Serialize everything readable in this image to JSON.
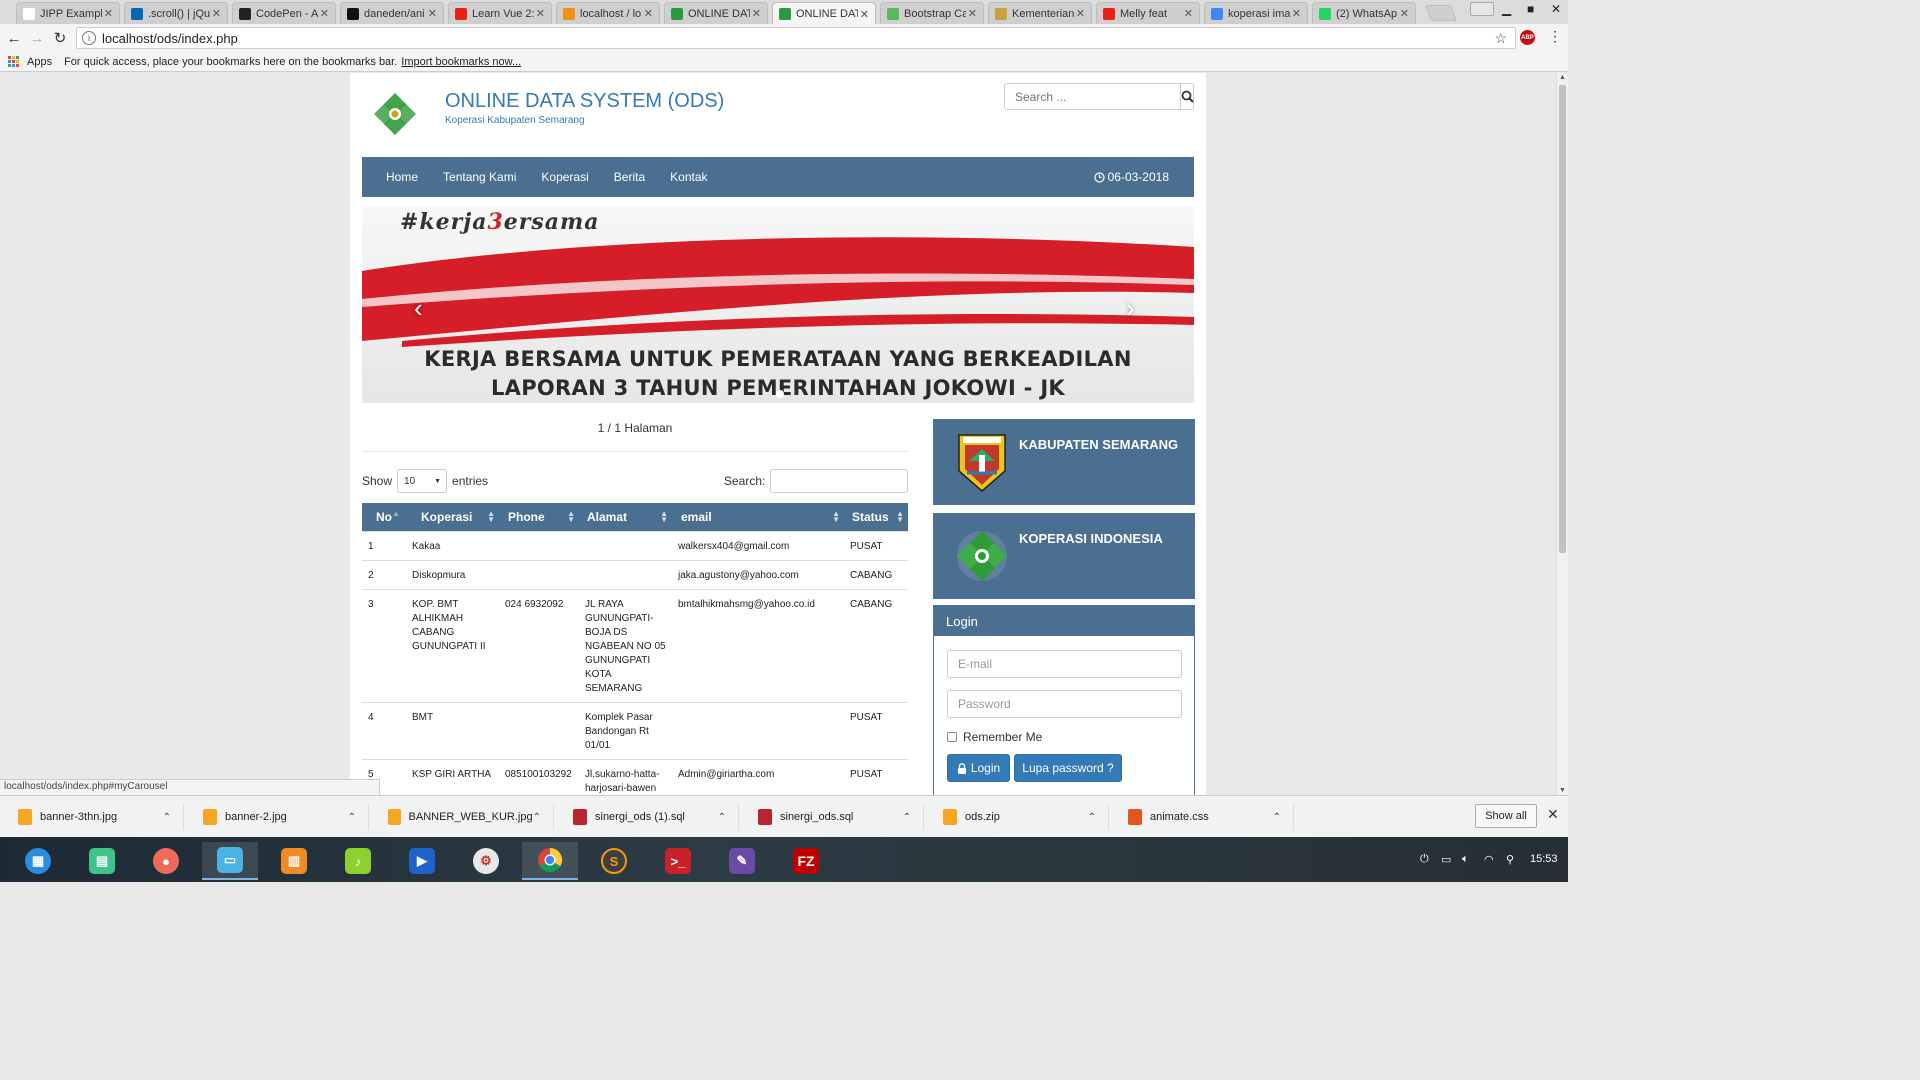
{
  "browser": {
    "tabs": [
      {
        "title": "JIPP Example",
        "fav_color": "#ffffff",
        "active": false
      },
      {
        "title": ".scroll() | jQu",
        "fav_color": "#0769ad",
        "active": false
      },
      {
        "title": "CodePen - Ai",
        "fav_color": "#222222",
        "active": false
      },
      {
        "title": "daneden/ani",
        "fav_color": "#111111",
        "active": false
      },
      {
        "title": "Learn Vue 2:",
        "fav_color": "#e62117",
        "active": false
      },
      {
        "title": "localhost / lo",
        "fav_color": "#f29111",
        "active": false
      },
      {
        "title": "ONLINE DAT",
        "fav_color": "#2b9a3e",
        "active": false
      },
      {
        "title": "ONLINE DAT",
        "fav_color": "#2b9a3e",
        "active": true
      },
      {
        "title": "Bootstrap Ca",
        "fav_color": "#5cb85c",
        "active": false
      },
      {
        "title": "Kementerian",
        "fav_color": "#c9a13b",
        "active": false
      },
      {
        "title": "Melly feat",
        "fav_color": "#e62117",
        "active": false
      },
      {
        "title": "koperasi ima",
        "fav_color": "#4285f4",
        "active": false
      },
      {
        "title": "(2) WhatsAp",
        "fav_color": "#25d366",
        "active": false
      }
    ],
    "url": "localhost/ods/index.php",
    "bookmarks": {
      "apps_label": "Apps",
      "hint": "For quick access, place your bookmarks here on the bookmarks bar.",
      "import_link": "Import bookmarks now..."
    },
    "status_url": "localhost/ods/index.php#myCarousel"
  },
  "site": {
    "title": "ONLINE DATA SYSTEM (ODS)",
    "subtitle": "Koperasi Kabupaten Semarang",
    "search_placeholder": "Search ...",
    "nav": [
      "Home",
      "Tentang Kami",
      "Koperasi",
      "Berita",
      "Kontak"
    ],
    "date": "06-03-2018",
    "banner": {
      "hashtag_prefix": "#kerja",
      "hashtag_mid": "3",
      "hashtag_suffix": "ersama",
      "line1": "KERJA BERSAMA UNTUK PEMERATAAN YANG BERKEADILAN",
      "line2": "LAPORAN 3 TAHUN PEMERINTAHAN JOKOWI - JK"
    },
    "pager": "1 / 1 Halaman",
    "table": {
      "show_label": "Show",
      "entries_value": "10",
      "entries_label": "entries",
      "search_label": "Search:",
      "columns": [
        "No",
        "Koperasi",
        "Phone",
        "Alamat",
        "email",
        "Status"
      ],
      "rows": [
        {
          "no": "1",
          "koperasi": "Kakaa",
          "phone": "",
          "alamat": "",
          "email": "walkersx404@gmail.com",
          "status": "PUSAT"
        },
        {
          "no": "2",
          "koperasi": "Diskopmura",
          "phone": "",
          "alamat": "",
          "email": "jaka.agustony@yahoo.com",
          "status": "CABANG"
        },
        {
          "no": "3",
          "koperasi": "KOP. BMT ALHIKMAH CABANG GUNUNGPATI II",
          "phone": "024 6932092",
          "alamat": "JL RAYA GUNUNGPATI-BOJA DS NGABEAN NO 05 GUNUNGPATI KOTA SEMARANG",
          "email": "bmtalhikmahsmg@yahoo.co.id",
          "status": "CABANG"
        },
        {
          "no": "4",
          "koperasi": "BMT",
          "phone": "",
          "alamat": "Komplek Pasar Bandongan Rt 01/01",
          "email": "",
          "status": "PUSAT"
        },
        {
          "no": "5",
          "koperasi": "KSP GIRI ARTHA",
          "phone": "085100103292",
          "alamat": "Jl.sukarno-hatta-harjosari-bawen",
          "email": "Admin@giriartha.com",
          "status": "PUSAT"
        }
      ]
    },
    "sidebar": {
      "kabupaten_title": "KABUPATEN SEMARANG",
      "koperasi_title": "KOPERASI INDONESIA",
      "login": {
        "heading": "Login",
        "email_placeholder": "E-mail",
        "password_placeholder": "Password",
        "remember": "Remember Me",
        "login_btn": "Login",
        "forgot_btn": "Lupa password ?"
      }
    }
  },
  "downloads": {
    "files": [
      "banner-3thn.jpg",
      "banner-2.jpg",
      "BANNER_WEB_KUR.jpg",
      "sinergi_ods (1).sql",
      "sinergi_ods.sql",
      "ods.zip",
      "animate.css"
    ],
    "show_all": "Show all"
  },
  "taskbar": {
    "time": "15:53"
  },
  "colors": {
    "nav_bg": "#4a6f91",
    "link_blue": "#337ab7",
    "banner_red": "#d51e28"
  }
}
